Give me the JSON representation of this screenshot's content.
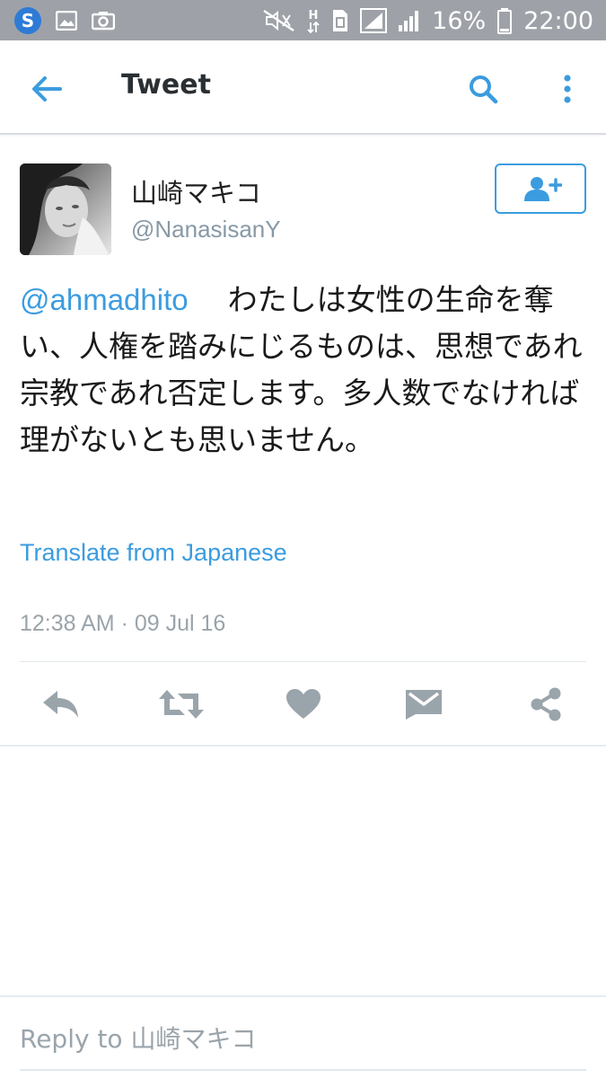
{
  "status_bar": {
    "battery_percent": "16%",
    "time": "22:00",
    "icons": [
      "s-app-icon",
      "image-icon",
      "camera-icon",
      "mute-icon",
      "h-data-icon",
      "sim-icon",
      "signal-icon",
      "signal-icon-2",
      "battery-icon"
    ]
  },
  "toolbar": {
    "title": "Tweet",
    "icons": [
      "back-arrow-icon",
      "search-icon",
      "more-vertical-icon"
    ]
  },
  "tweet": {
    "display_name": "山崎マキコ",
    "handle": "@NanasisanY",
    "mention": "@ahmadhito",
    "text": "わたしは女性の生命を奪い、人権を踏みにじるものは、思想であれ宗教であれ否定します。多人数でなければ理がないとも思いません。",
    "translate_label": "Translate from Japanese",
    "timestamp": "12:38 AM · 09 Jul 16"
  },
  "actions": [
    "reply-icon",
    "retweet-icon",
    "like-icon",
    "direct-message-icon",
    "share-icon"
  ],
  "reply": {
    "placeholder": "Reply to 山崎マキコ"
  },
  "colors": {
    "accent": "#3b9cdf",
    "status_bar": "#9ea2a8",
    "action_icons": "#9aa4ab",
    "meta_text": "#8899a6"
  }
}
